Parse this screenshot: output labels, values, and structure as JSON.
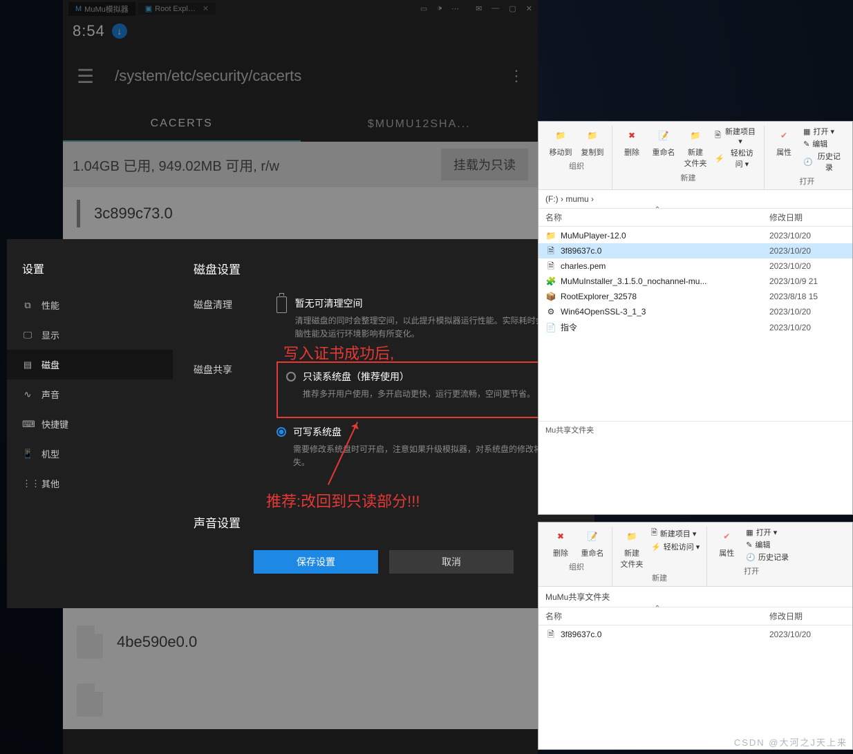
{
  "emulator": {
    "tabs": [
      {
        "label": "MuMu模拟器",
        "icon": "M"
      },
      {
        "label": "Root Expl…"
      }
    ],
    "status_time": "8:54",
    "app_path": "/system/etc/security/cacerts",
    "file_tabs": {
      "active": "CACERTS",
      "other": "$MUMU12SHA..."
    },
    "storage_line": "1.04GB 已用, 949.02MB 可用, r/w",
    "mount_btn": "挂载为只读",
    "top_partial_file": "3c899c73.0",
    "bottom_file": "4be590e0.0"
  },
  "settings": {
    "title": "设置",
    "items": [
      {
        "icon": "⧉",
        "label": "性能"
      },
      {
        "icon": "🖵",
        "label": "显示"
      },
      {
        "icon": "▤",
        "label": "磁盘",
        "active": true
      },
      {
        "icon": "∿",
        "label": "声音"
      },
      {
        "icon": "⌨",
        "label": "快捷键"
      },
      {
        "icon": "📱",
        "label": "机型"
      },
      {
        "icon": "⋮⋮",
        "label": "其他"
      }
    ],
    "header": "磁盘设置",
    "disk_clean_label": "磁盘清理",
    "disk_clean_title": "暂无可清理空间",
    "disk_clean_desc": "清理磁盘的同时会整理空间，以此提升模拟器运行性能。实际耗时会根据电脑性能及运行环境影响有所变化。",
    "disk_share_label": "磁盘共享",
    "opt1_title": "只读系统盘（推荐使用）",
    "opt1_desc": "推荐多开用户使用，多开启动更快，运行更流畅，空间更节省。",
    "opt2_title": "可写系统盘",
    "opt2_desc": "需要修改系统盘时可开启，注意如果升级模拟器，对系统盘的修改将会消失。",
    "sound_header": "声音设置",
    "save_btn": "保存设置",
    "cancel_btn": "取消",
    "annotation1": "写入证书成功后,",
    "annotation2": "推荐:改回到只读部分!!!"
  },
  "explorer1": {
    "ribbon": {
      "org": {
        "move": "移动到",
        "copy": "复制到",
        "group": "组织"
      },
      "newg": {
        "delete": "删除",
        "rename": "重命名",
        "newfolder": "新建\n文件夹",
        "newitem": "新建项目 ▾",
        "easy": "轻松访问 ▾",
        "group": "新建"
      },
      "open": {
        "props": "属性",
        "openbtn": "打开 ▾",
        "edit": "编辑",
        "history": "历史记录",
        "group": "打开"
      }
    },
    "breadcrumb": "(F:) › mumu ›",
    "cols": {
      "name": "名称",
      "date": "修改日期"
    },
    "files": [
      {
        "icon": "📁",
        "name": "MuMuPlayer-12.0",
        "date": "2023/10/20 "
      },
      {
        "icon": "🗎",
        "name": "3f89637c.0",
        "date": "2023/10/20 ",
        "sel": true
      },
      {
        "icon": "🗎",
        "name": "charles.pem",
        "date": "2023/10/20 "
      },
      {
        "icon": "🧩",
        "name": "MuMuInstaller_3.1.5.0_nochannel-mu...",
        "date": "2023/10/9 21"
      },
      {
        "icon": "📦",
        "name": "RootExplorer_32578",
        "date": "2023/8/18 15"
      },
      {
        "icon": "⚙",
        "name": "Win64OpenSSL-3_1_3",
        "date": "2023/10/20 "
      },
      {
        "icon": "📄",
        "name": "指令",
        "date": "2023/10/20 "
      }
    ],
    "footer": "Mu共享文件夹"
  },
  "explorer2": {
    "ribbon": {
      "newg": {
        "delete": "删除",
        "rename": "重命名",
        "newfolder": "新建\n文件夹",
        "newitem": "新建项目 ▾",
        "easy": "轻松访问 ▾",
        "group": "新建"
      },
      "open": {
        "props": "属性",
        "openbtn": "打开 ▾",
        "edit": "编辑",
        "history": "历史记录",
        "group": "打开"
      },
      "org_group": "组织"
    },
    "breadcrumb": "MuMu共享文件夹",
    "cols": {
      "name": "名称",
      "date": "修改日期"
    },
    "files": [
      {
        "icon": "🗎",
        "name": "3f89637c.0",
        "date": "2023/10/20 "
      }
    ]
  },
  "watermark": "CSDN @大河之J天上来"
}
